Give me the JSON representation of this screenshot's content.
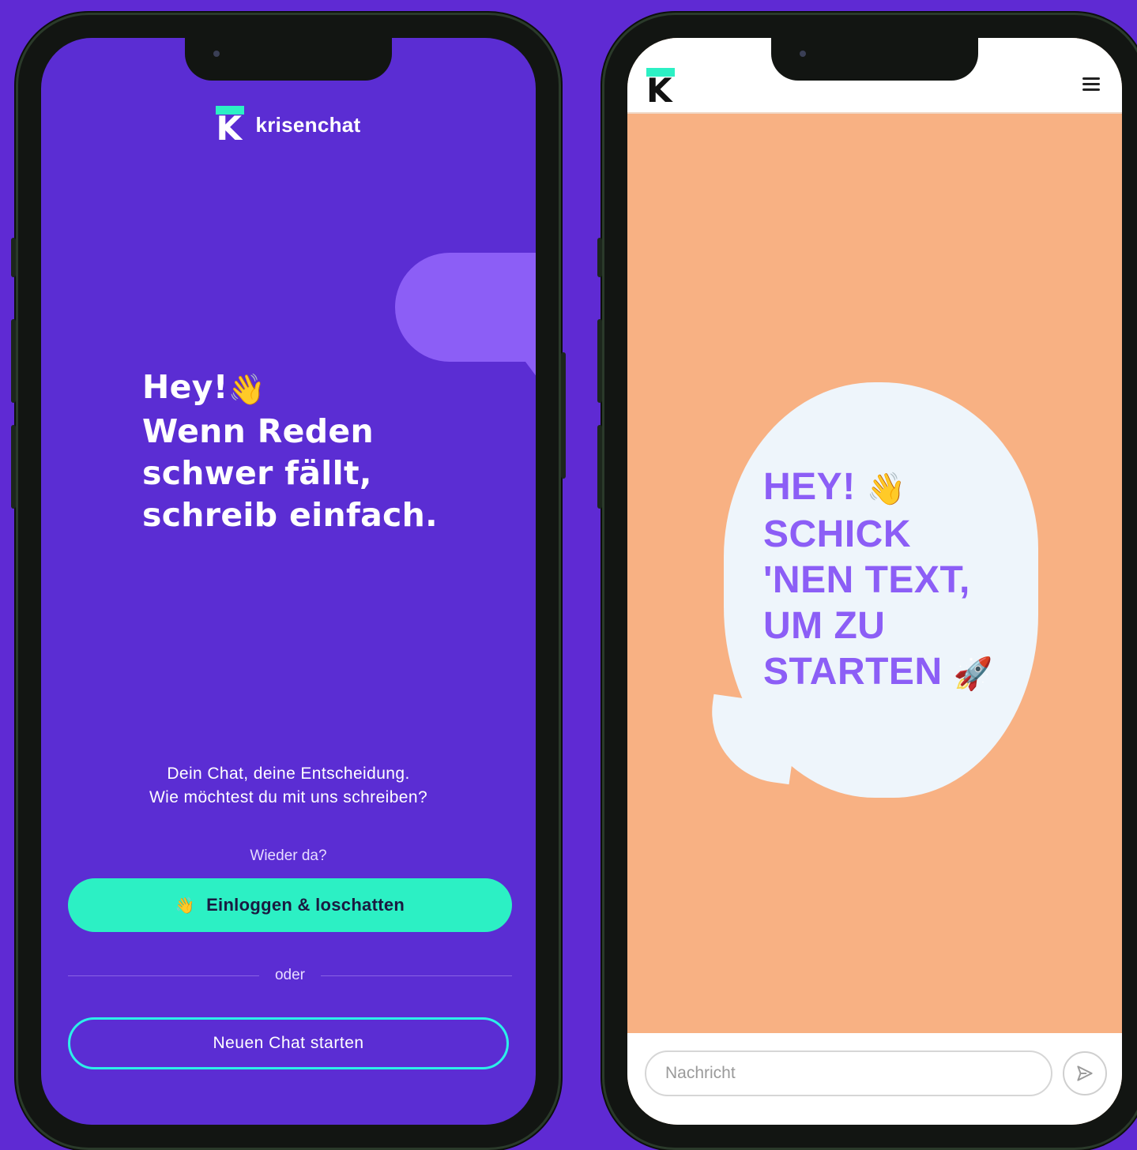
{
  "left_screen": {
    "brand": {
      "logo_letter": "K",
      "name": "krisenchat"
    },
    "headline": {
      "line1": "Hey!",
      "line1_emoji": "👋",
      "line2": "Wenn Reden",
      "line3": "schwer fällt,",
      "line4": "schreib einfach."
    },
    "subtext": {
      "line1": "Dein Chat, deine Entscheidung.",
      "line2": "Wie möchtest du mit uns schreiben?"
    },
    "returning_label": "Wieder da?",
    "login_button": {
      "icon": "👋",
      "label": "Einloggen & loschatten"
    },
    "divider_label": "oder",
    "new_chat_button": {
      "label": "Neuen Chat starten"
    }
  },
  "right_screen": {
    "logo_letter": "K",
    "menu_icon": "hamburger-menu-icon",
    "bubble": {
      "line1": "HEY!",
      "line1_emoji": "👋",
      "line2": "SCHICK",
      "line3": "'NEN TEXT,",
      "line4": "UM ZU",
      "line5": "STARTEN",
      "line5_emoji": "🚀"
    },
    "message_input": {
      "placeholder": "Nachricht",
      "value": ""
    },
    "send_icon": "send-icon"
  },
  "colors": {
    "background": "#5f2ad3",
    "left_screen_bg": "#5b2dd3",
    "accent_mint": "#2cf0c4",
    "bubble_purple": "#8c5ef6",
    "right_screen_bg": "#f8b183",
    "bubble_white": "#eef5fb"
  }
}
